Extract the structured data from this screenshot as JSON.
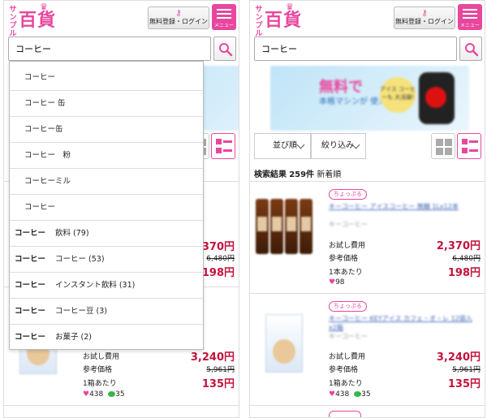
{
  "header": {
    "logo_small": "サンプル",
    "logo_main": "百貨店",
    "login_label": "無料登録・ログイン",
    "menu_label": "メニュー"
  },
  "search": {
    "value": "コーヒー"
  },
  "banner": {
    "headline": "無料で",
    "subline": "本格マシンが 使えます!",
    "badge": "アイス コーヒーも 大活躍!"
  },
  "toolbar": {
    "sort_label": "並び順",
    "filter_label": "絞り込み"
  },
  "results": {
    "label": "検索結果",
    "count": "259件",
    "order": "新着順"
  },
  "suggestions": [
    {
      "bold": "",
      "text": "コーヒー"
    },
    {
      "bold": "",
      "text": "コーヒー 缶"
    },
    {
      "bold": "",
      "text": "コーヒー缶"
    },
    {
      "bold": "",
      "text": "コーヒー　粉"
    },
    {
      "bold": "",
      "text": "コーヒーミル"
    },
    {
      "bold": "",
      "text": "コーヒー"
    },
    {
      "bold": "コーヒー",
      "text": "飲料 (79)"
    },
    {
      "bold": "コーヒー",
      "text": "コーヒー (53)"
    },
    {
      "bold": "コーヒー",
      "text": "インスタント飲料 (31)"
    },
    {
      "bold": "コーヒー",
      "text": "コーヒー豆 (3)"
    },
    {
      "bold": "コーヒー",
      "text": "お菓子 (2)"
    }
  ],
  "items": [
    {
      "tag": "ちょっぷる",
      "title": "キーコーヒー アイスコーヒー 無糖 1Lx12本",
      "subtitle": "キーコーヒー",
      "trial_label": "お試し費用",
      "trial_price": "2,370円",
      "ref_label": "参考価格",
      "ref_price": "6,480円",
      "unit_label": "1本あたり",
      "unit_price": "198円",
      "likes": "98",
      "comments": ""
    },
    {
      "tag": "ちょっぷる",
      "title": "キーコーヒー KEYアイス カフェ・オ・レ 12袋入x2箱",
      "subtitle": "キーコーヒー",
      "trial_label": "お試し費用",
      "trial_price": "3,240円",
      "ref_label": "参考価格",
      "ref_price": "5,961円",
      "unit_label": "1箱あたり",
      "unit_price": "135円",
      "likes": "438",
      "comments": "35"
    }
  ],
  "left_partial": {
    "trial_price_1": "370円",
    "ref_price_1": "6,480円",
    "unit_price_1": "198円"
  },
  "colors": {
    "brand_pink": "#e8479d",
    "price_red": "#c4123c",
    "link_blue": "#3b62b5"
  },
  "icons": [
    "key-icon",
    "hamburger-icon",
    "search-icon",
    "grid-view-icon",
    "list-view-icon",
    "chevron-down-icon",
    "heart-icon",
    "comment-icon"
  ]
}
